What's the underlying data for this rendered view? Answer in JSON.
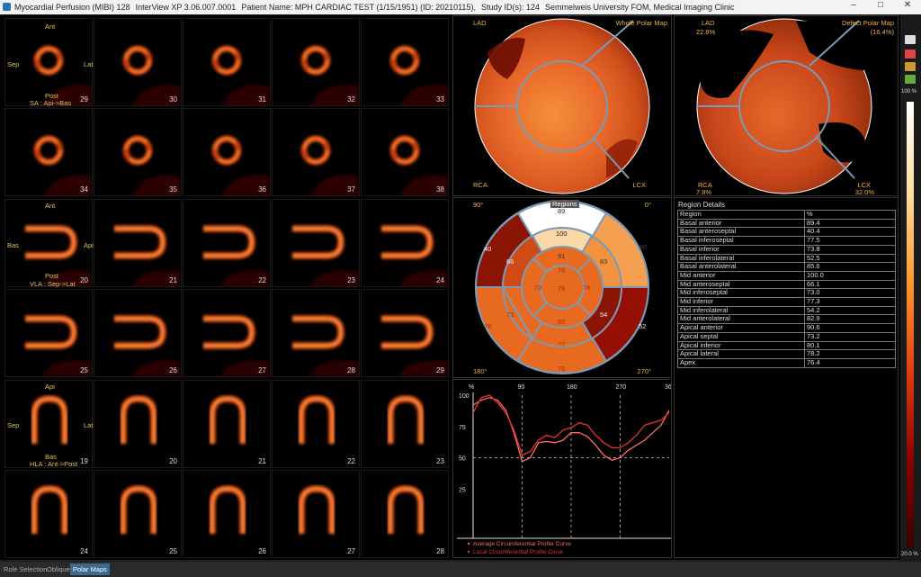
{
  "titlebar": {
    "app": "Myocardial Perfusion (MIBI) 128",
    "version": "InterView XP 3.06.007.0001",
    "patient": "Patient Name: MPH CARDIAC TEST (1/15/1951) (ID: 20210115),",
    "study": "Study ID(s): 124",
    "institution": "Semmelweis University FOM, Medical Imaging Clinic",
    "minimize": "–",
    "maximize": "□",
    "close": "✕"
  },
  "sa": {
    "ant": "Ant",
    "sep": "Sep",
    "lat": "Lat",
    "post": "Post",
    "axis": "SA : Api->Bas",
    "slices_row1": [
      "29",
      "30",
      "31",
      "32",
      "33"
    ],
    "slices_row2": [
      "34",
      "35",
      "36",
      "37",
      "38"
    ]
  },
  "vla": {
    "ant": "Ant",
    "bas": "Bas",
    "api": "Api",
    "post": "Post",
    "axis": "VLA : Sep->Lat",
    "slices_row1": [
      "20",
      "21",
      "22",
      "23",
      "24"
    ],
    "slices_row2": [
      "25",
      "26",
      "27",
      "28",
      "29"
    ]
  },
  "hla": {
    "api": "Api",
    "sep": "Sep",
    "lat": "Lat",
    "bas": "Bas",
    "axis": "HLA : Ant->Post",
    "slices_row1": [
      "19",
      "20",
      "21",
      "22",
      "23"
    ],
    "slices_row2": [
      "24",
      "25",
      "26",
      "27",
      "28"
    ]
  },
  "whole_map": {
    "title": "Whole Polar Map",
    "lad": "LAD",
    "rca": "RCA",
    "lcx": "LCX"
  },
  "defect_map": {
    "title": "Defect Polar Map",
    "pct": "(16.4%)",
    "lad": "LAD",
    "lad_pct": "22.8%",
    "rca": "RCA",
    "rca_pct": "7.8%",
    "lcx": "LCX",
    "lcx_pct": "32.0%"
  },
  "regions_map": {
    "title": "Regions",
    "top_left": "90°",
    "top_right": "0°",
    "bottom_left": "180°",
    "bottom_right": "270°",
    "values": {
      "outer_top": "89",
      "outer_top_inner": "100",
      "outer_left": "40",
      "outer_right": "86",
      "outer_bottom_left": "78",
      "outer_bottom": "76",
      "outer_bottom_right": "52",
      "mid_left": "66",
      "mid_top": "91",
      "mid_right": "83",
      "mid_bl": "73",
      "mid_bottom": "77",
      "mid_br": "54",
      "inner_top": "76",
      "inner_left": "73",
      "inner_right": "78",
      "inner_bottom": "80",
      "apex": "76"
    }
  },
  "region_details": {
    "title": "Region Details",
    "headers": [
      "Region",
      "%"
    ],
    "rows": [
      [
        "Basal anterior",
        "89.4"
      ],
      [
        "Basal anteroseptal",
        "40.4"
      ],
      [
        "Basal inferoseptal",
        "77.5"
      ],
      [
        "Basal inferior",
        "73.8"
      ],
      [
        "Basal inferolateral",
        "52.5"
      ],
      [
        "Basal anterolateral",
        "85.6"
      ],
      [
        "Mid anterior",
        "100.0"
      ],
      [
        "Mid anteroseptal",
        "66.1"
      ],
      [
        "Mid inferoseptal",
        "73.0"
      ],
      [
        "Mid inferior",
        "77.3"
      ],
      [
        "Mid inferolateral",
        "54.2"
      ],
      [
        "Mid anterolateral",
        "82.9"
      ],
      [
        "Apical anterior",
        "90.6"
      ],
      [
        "Apical septal",
        "73.2"
      ],
      [
        "Apical inferior",
        "80.1"
      ],
      [
        "Apical lateral",
        "78.2"
      ],
      [
        "Apex",
        "76.4"
      ]
    ]
  },
  "chart_data": {
    "type": "line",
    "ylabel": "%",
    "xticks": [
      "90",
      "180",
      "270",
      "360"
    ],
    "yticks": [
      "100",
      "75",
      "50",
      "25"
    ],
    "xlim": [
      0,
      360
    ],
    "ylim": [
      0,
      100
    ],
    "series": [
      {
        "name": "Average Circumferential Profile Curve",
        "color": "#ff6b6b",
        "x": [
          0,
          15,
          30,
          45,
          60,
          75,
          90,
          105,
          120,
          135,
          150,
          165,
          180,
          195,
          210,
          225,
          240,
          255,
          270,
          285,
          300,
          315,
          330,
          345,
          360
        ],
        "y": [
          92,
          96,
          98,
          96,
          88,
          70,
          47,
          50,
          62,
          63,
          62,
          64,
          70,
          70,
          67,
          60,
          52,
          48,
          50,
          56,
          60,
          64,
          70,
          76,
          88
        ]
      },
      {
        "name": "Local Circumferential Profile Curve",
        "color": "#e8332e",
        "x": [
          0,
          15,
          30,
          45,
          60,
          75,
          90,
          105,
          120,
          135,
          150,
          165,
          180,
          195,
          210,
          225,
          240,
          255,
          270,
          285,
          300,
          315,
          330,
          345,
          360
        ],
        "y": [
          86,
          98,
          100,
          94,
          86,
          72,
          52,
          55,
          64,
          68,
          66,
          72,
          74,
          78,
          76,
          68,
          62,
          58,
          58,
          62,
          68,
          76,
          78,
          80,
          86
        ]
      }
    ]
  },
  "colorbar": {
    "top": "100 %",
    "bottom": "20.0 %"
  },
  "tabs": [
    "Role Selection",
    "Oblique",
    "Polar Maps"
  ]
}
